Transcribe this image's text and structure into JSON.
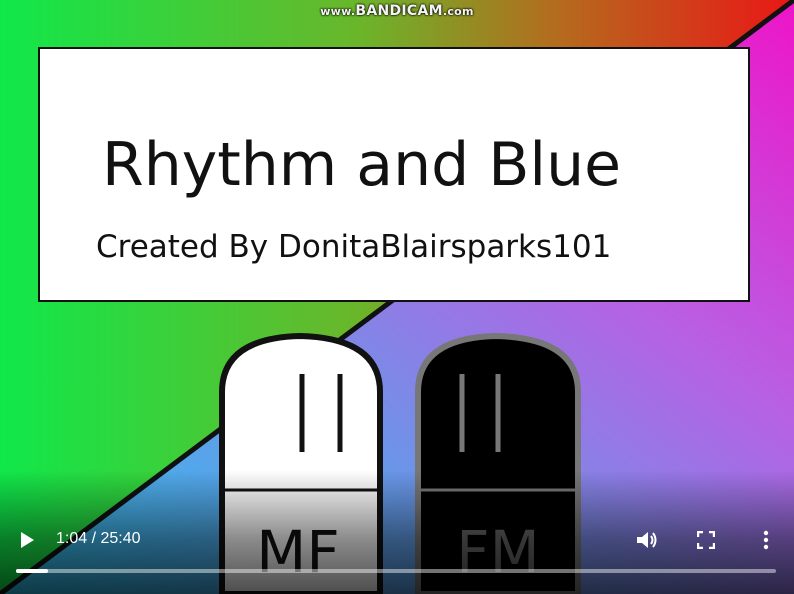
{
  "watermark": {
    "prefix": "www.",
    "brand": "BANDICAM",
    "suffix": ".com"
  },
  "title_card": {
    "title": "Rhythm and Blue",
    "credit": "Created By DonitaBlairsparks101"
  },
  "characters": {
    "left_marking": "MF",
    "right_marking": "FM"
  },
  "player": {
    "current_time": "1:04",
    "duration": "25:40",
    "time_label": "1:04 / 25:40",
    "progress_fraction": 0.0416,
    "icons": {
      "play": "play-icon",
      "volume": "volume-icon",
      "fullscreen": "fullscreen-icon",
      "more": "more-vertical-icon"
    }
  },
  "colors": {
    "top_left": "#10e84a",
    "top_right": "#e81414",
    "bottom_left": "#2fb4f0",
    "bottom_right": "#e81cd0"
  }
}
